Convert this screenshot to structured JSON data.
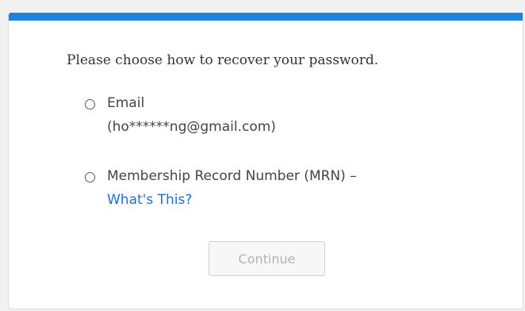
{
  "colors": {
    "accent": "#1a85e0",
    "link": "#1e6fd0",
    "disabled_text": "#b3b3b3"
  },
  "recovery": {
    "prompt": "Please choose how to recover your password.",
    "options": [
      {
        "label": "Email",
        "detail": "(ho******ng@gmail.com)",
        "selected": false
      },
      {
        "label": "Membership Record Number (MRN) –",
        "link": "What's This?",
        "selected": false
      }
    ],
    "continue_label": "Continue",
    "continue_disabled": true
  }
}
